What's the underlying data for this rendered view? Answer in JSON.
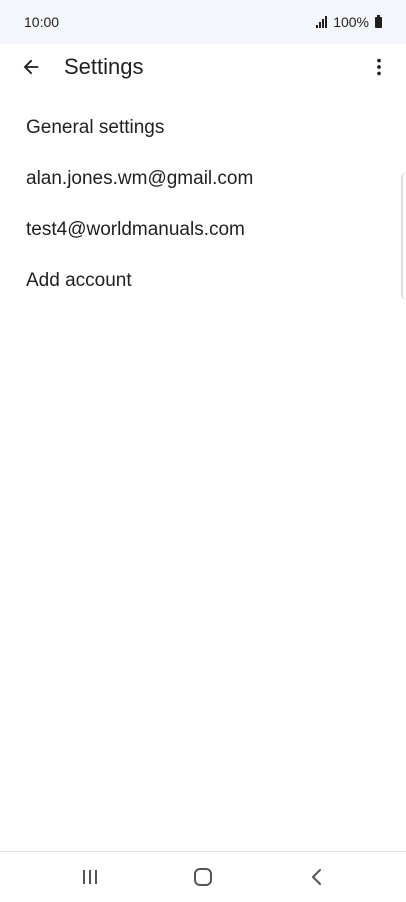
{
  "status_bar": {
    "time": "10:00",
    "battery": "100%"
  },
  "app_bar": {
    "title": "Settings"
  },
  "settings": {
    "items": [
      {
        "label": "General settings"
      },
      {
        "label": "alan.jones.wm@gmail.com"
      },
      {
        "label": "test4@worldmanuals.com"
      },
      {
        "label": "Add account"
      }
    ]
  },
  "icons": {
    "back": "arrow-back-icon",
    "more": "more-vertical-icon",
    "recents": "recents-icon",
    "home": "home-icon",
    "nav_back": "chevron-left-icon"
  },
  "colors": {
    "status_bar_bg": "#f4f6fb",
    "text": "#1f1f1f"
  }
}
